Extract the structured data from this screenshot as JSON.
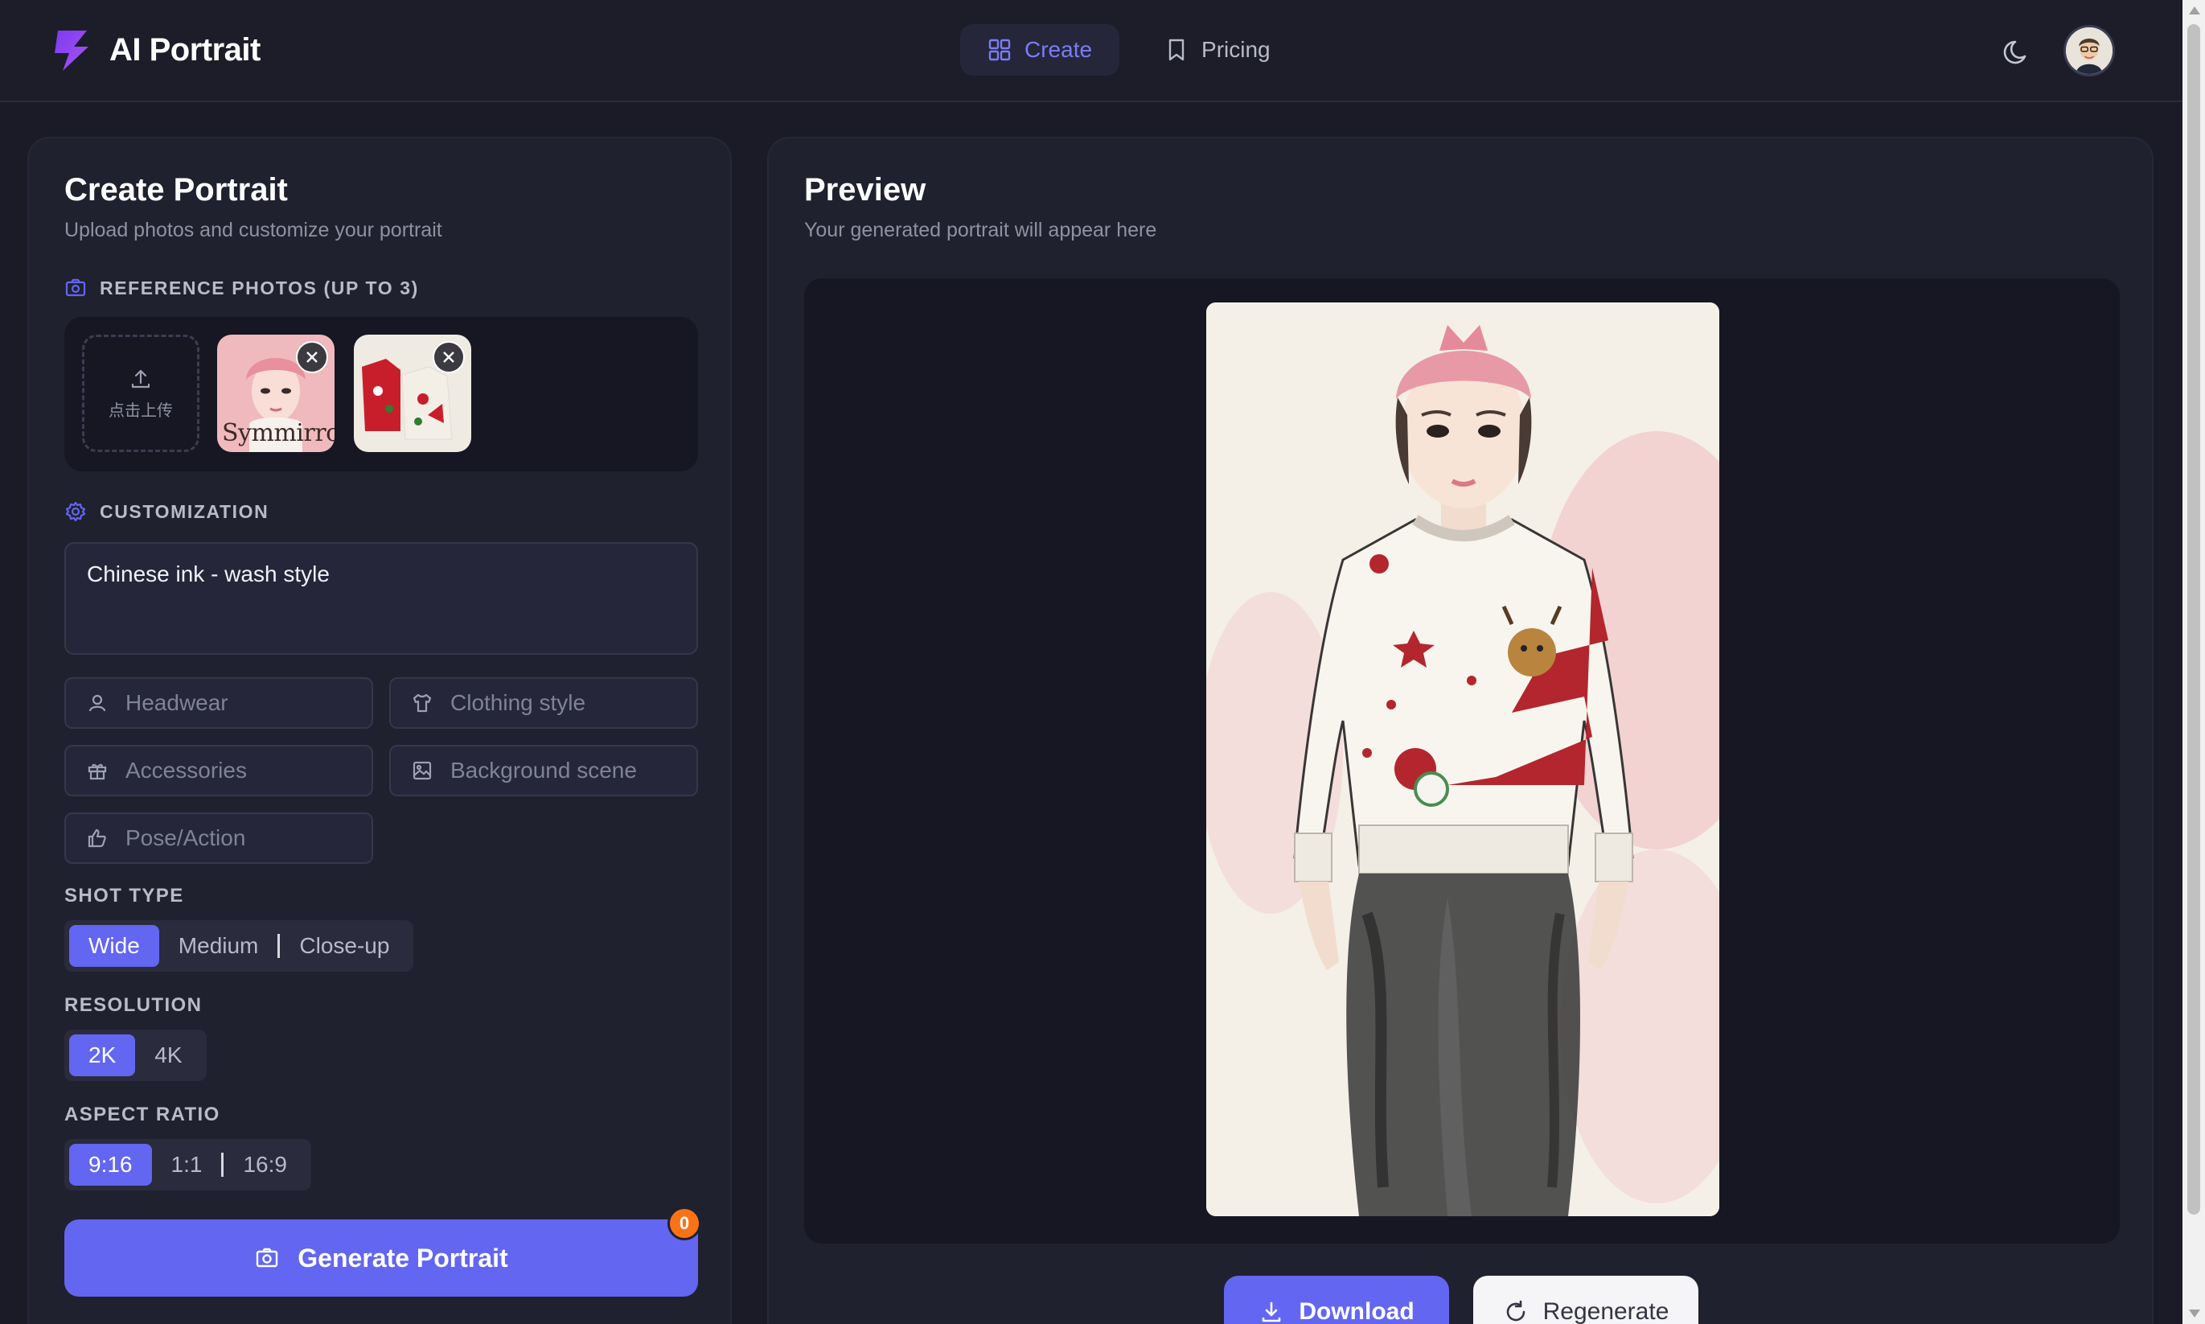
{
  "app": {
    "title": "AI Portrait"
  },
  "nav": {
    "create": "Create",
    "pricing": "Pricing"
  },
  "left": {
    "title": "Create Portrait",
    "subtitle": "Upload photos and customize your portrait",
    "reference_label": "REFERENCE PHOTOS (UP TO 3)",
    "upload_text": "点击上传",
    "thumb1_caption": "Symmirror",
    "customization_label": "CUSTOMIZATION",
    "custom_value": "Chinese ink - wash style",
    "fields": {
      "headwear": "Headwear",
      "clothing": "Clothing style",
      "accessories": "Accessories",
      "background": "Background scene",
      "pose": "Pose/Action"
    },
    "shot_type_label": "SHOT TYPE",
    "shot_types": [
      "Wide",
      "Medium",
      "Close-up"
    ],
    "resolution_label": "RESOLUTION",
    "resolutions": [
      "2K",
      "4K"
    ],
    "aspect_label": "ASPECT RATIO",
    "aspects": [
      "9:16",
      "1:1",
      "16:9"
    ],
    "generate_label": "Generate Portrait",
    "credits": "0"
  },
  "right": {
    "title": "Preview",
    "subtitle": "Your generated portrait will appear here",
    "download": "Download",
    "regenerate": "Regenerate"
  },
  "colors": {
    "accent": "#6366f1",
    "badge": "#f97316",
    "bg": "#1a1b26",
    "panel": "#20212e"
  }
}
